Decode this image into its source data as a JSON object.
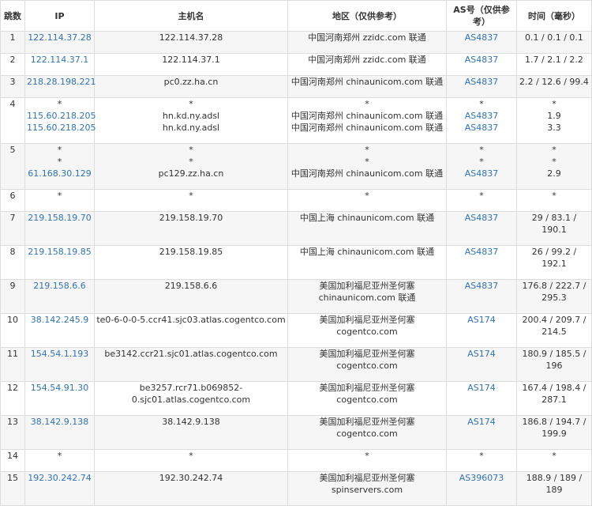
{
  "header": {
    "hop": "跳数",
    "ip": "IP",
    "host": "主机名",
    "region": "地区（仅供参考）",
    "asn": "AS号（仅供参考）",
    "time": "时间（毫秒）"
  },
  "rows": [
    {
      "hop": "1",
      "ips": [
        "122.114.37.28"
      ],
      "hosts": [
        "122.114.37.28"
      ],
      "regions": [
        "中国河南郑州 zzidc.com 联通"
      ],
      "asns": [
        "AS4837"
      ],
      "time": [
        "0.1 / 0.1 / 0.1"
      ]
    },
    {
      "hop": "2",
      "ips": [
        "122.114.37.1"
      ],
      "hosts": [
        "122.114.37.1"
      ],
      "regions": [
        "中国河南郑州 zzidc.com 联通"
      ],
      "asns": [
        "AS4837"
      ],
      "time": [
        "1.7 / 2.1 / 2.2"
      ]
    },
    {
      "hop": "3",
      "ips": [
        "218.28.198.221"
      ],
      "hosts": [
        "pc0.zz.ha.cn"
      ],
      "regions": [
        "中国河南郑州 chinaunicom.com 联通"
      ],
      "asns": [
        "AS4837"
      ],
      "time": [
        "2.2 / 12.6 / 99.4"
      ]
    },
    {
      "hop": "4",
      "ips": [
        "*",
        "115.60.218.205",
        "115.60.218.205"
      ],
      "hosts": [
        "*",
        "hn.kd.ny.adsl",
        "hn.kd.ny.adsl"
      ],
      "regions": [
        "*",
        "中国河南郑州 chinaunicom.com 联通",
        "中国河南郑州 chinaunicom.com 联通"
      ],
      "asns": [
        "*",
        "AS4837",
        "AS4837"
      ],
      "time": [
        "*",
        "1.9",
        "3.3"
      ]
    },
    {
      "hop": "5",
      "ips": [
        "*",
        "*",
        "61.168.30.129"
      ],
      "hosts": [
        "*",
        "*",
        "pc129.zz.ha.cn"
      ],
      "regions": [
        "*",
        "*",
        "中国河南郑州 chinaunicom.com 联通"
      ],
      "asns": [
        "*",
        "*",
        "AS4837"
      ],
      "time": [
        "*",
        "*",
        "2.9"
      ]
    },
    {
      "hop": "6",
      "ips": [
        "*"
      ],
      "hosts": [
        "*"
      ],
      "regions": [
        "*"
      ],
      "asns": [
        "*"
      ],
      "time": [
        "*"
      ]
    },
    {
      "hop": "7",
      "ips": [
        "219.158.19.70"
      ],
      "hosts": [
        "219.158.19.70"
      ],
      "regions": [
        "中国上海 chinaunicom.com 联通"
      ],
      "asns": [
        "AS4837"
      ],
      "time": [
        "29 / 83.1 /",
        "190.1"
      ]
    },
    {
      "hop": "8",
      "ips": [
        "219.158.19.85"
      ],
      "hosts": [
        "219.158.19.85"
      ],
      "regions": [
        "中国上海 chinaunicom.com 联通"
      ],
      "asns": [
        "AS4837"
      ],
      "time": [
        "26 / 99.2 /",
        "192.1"
      ]
    },
    {
      "hop": "9",
      "ips": [
        "219.158.6.6"
      ],
      "hosts": [
        "219.158.6.6"
      ],
      "regions": [
        "美国加利福尼亚州圣何塞",
        "chinaunicom.com 联通"
      ],
      "asns": [
        "AS4837"
      ],
      "time": [
        "176.8 / 222.7 /",
        "295.3"
      ]
    },
    {
      "hop": "10",
      "ips": [
        "38.142.245.9"
      ],
      "hosts": [
        "te0-6-0-0-5.ccr41.sjc03.atlas.cogentco.com"
      ],
      "regions": [
        "美国加利福尼亚州圣何塞",
        "cogentco.com"
      ],
      "asns": [
        "AS174"
      ],
      "time": [
        "200.4 / 209.7 /",
        "214.5"
      ]
    },
    {
      "hop": "11",
      "ips": [
        "154.54.1.193"
      ],
      "hosts": [
        "be3142.ccr21.sjc01.atlas.cogentco.com"
      ],
      "regions": [
        "美国加利福尼亚州圣何塞",
        "cogentco.com"
      ],
      "asns": [
        "AS174"
      ],
      "time": [
        "180.9 / 185.5 /",
        "196"
      ]
    },
    {
      "hop": "12",
      "ips": [
        "154.54.91.30"
      ],
      "hosts": [
        "be3257.rcr71.b069852-",
        "0.sjc01.atlas.cogentco.com"
      ],
      "regions": [
        "美国加利福尼亚州圣何塞",
        "cogentco.com"
      ],
      "asns": [
        "AS174"
      ],
      "time": [
        "167.4 / 198.4 /",
        "287.1"
      ]
    },
    {
      "hop": "13",
      "ips": [
        "38.142.9.138"
      ],
      "hosts": [
        "38.142.9.138"
      ],
      "regions": [
        "美国加利福尼亚州圣何塞",
        "cogentco.com"
      ],
      "asns": [
        "AS174"
      ],
      "time": [
        "186.8 / 194.7 /",
        "199.9"
      ]
    },
    {
      "hop": "14",
      "ips": [
        "*"
      ],
      "hosts": [
        "*"
      ],
      "regions": [
        "*"
      ],
      "asns": [
        "*"
      ],
      "time": [
        "*"
      ]
    },
    {
      "hop": "15",
      "ips": [
        "192.30.242.74"
      ],
      "hosts": [
        "192.30.242.74"
      ],
      "regions": [
        "美国加利福尼亚州圣何塞",
        "spinservers.com"
      ],
      "asns": [
        "AS396073"
      ],
      "time": [
        "188.9 / 189 /",
        "189"
      ]
    }
  ],
  "colors": {
    "link": "#2f73b8",
    "border": "#dddddd",
    "stripe": "#f6f6f6"
  }
}
